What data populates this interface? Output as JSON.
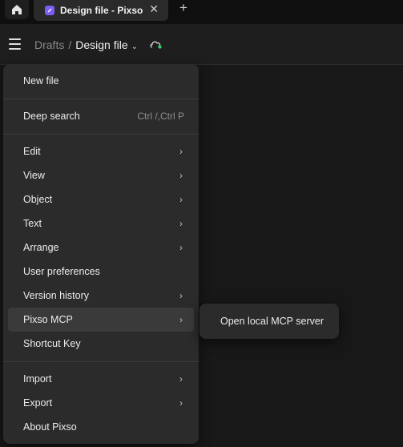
{
  "tabbar": {
    "tab_title": "Design file - Pixso",
    "close_symbol": "✕",
    "new_tab_symbol": "+"
  },
  "toolbar": {
    "breadcrumb_root": "Drafts",
    "breadcrumb_separator": "/",
    "breadcrumb_file": "Design file",
    "sync_status_color": "#2ecc71"
  },
  "menu": {
    "new_file": "New file",
    "deep_search": "Deep search",
    "deep_search_shortcut": "Ctrl /,Ctrl P",
    "edit": "Edit",
    "view": "View",
    "object": "Object",
    "text": "Text",
    "arrange": "Arrange",
    "user_preferences": "User preferences",
    "version_history": "Version history",
    "pixso_mcp": "Pixso MCP",
    "shortcut_key": "Shortcut Key",
    "import": "Import",
    "export": "Export",
    "about": "About Pixso"
  },
  "submenu": {
    "open_local_mcp_server": "Open local MCP server"
  },
  "colors": {
    "accent": "#7b5cf5"
  }
}
